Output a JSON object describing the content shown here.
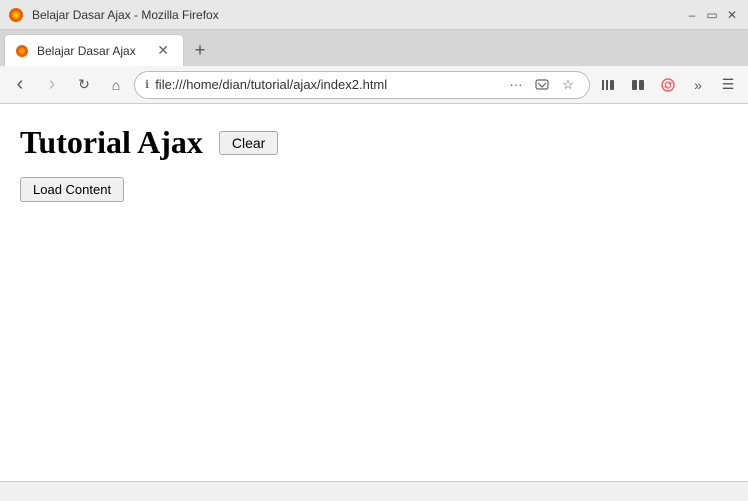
{
  "titlebar": {
    "title": "Belajar Dasar Ajax - Mozilla Firefox",
    "minimize_label": "–",
    "maximize_label": "▭",
    "close_label": "✕"
  },
  "tab": {
    "label": "Belajar Dasar Ajax",
    "close_label": "✕"
  },
  "tab_new_label": "+",
  "navbar": {
    "back_label": "‹",
    "forward_label": "›",
    "reload_label": "↻",
    "home_label": "⌂",
    "url": "file:///home/dian/tutorial/ajax/index2.html",
    "url_icon": "ℹ",
    "more_label": "···",
    "pocket_label": "⬡",
    "bookmark_label": "☆",
    "library_label": "📚",
    "reader_label": "≡",
    "firefox_sync_label": "🔥",
    "extensions_label": "»",
    "menu_label": "☰"
  },
  "page": {
    "title": "Tutorial Ajax",
    "clear_button_label": "Clear",
    "load_button_label": "Load Content"
  },
  "statusbar": {
    "text": ""
  }
}
